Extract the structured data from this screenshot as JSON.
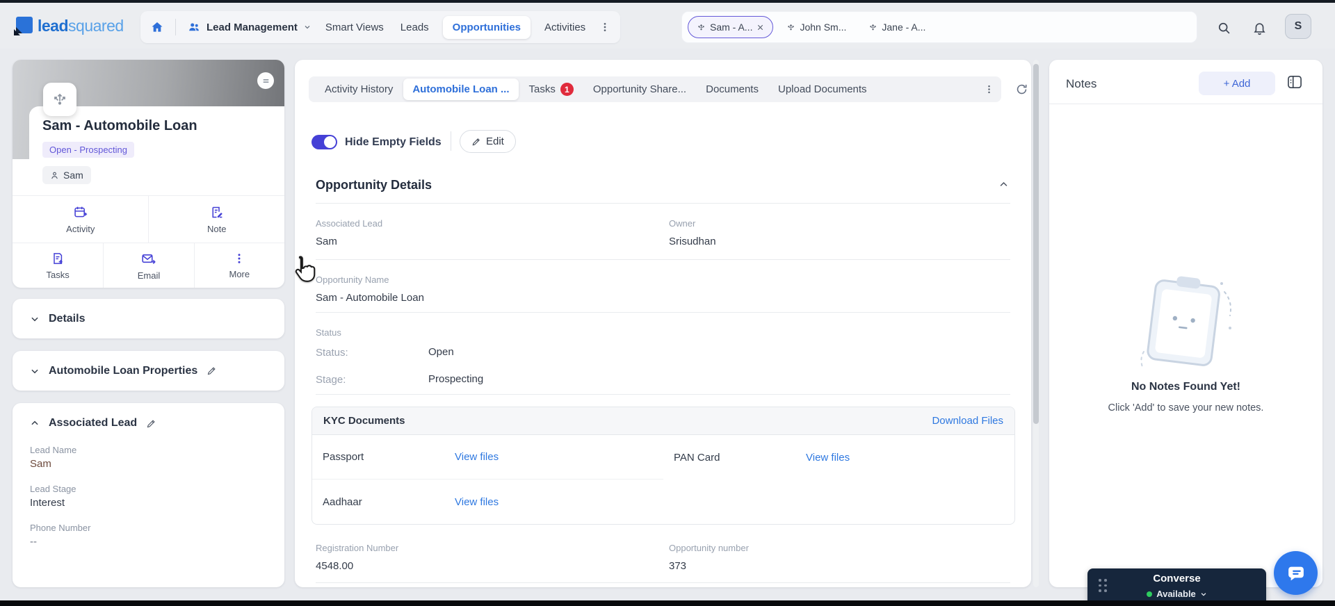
{
  "topbar": {
    "logo": {
      "part1": "lead",
      "part2": "squared"
    },
    "nav": {
      "lead_management": "Lead Management",
      "items": [
        "Smart Views",
        "Leads",
        "Opportunities",
        "Activities"
      ]
    },
    "chips": [
      {
        "label": "Sam - A...",
        "selected": true,
        "closable": true
      },
      {
        "label": "John Sm...",
        "selected": false
      },
      {
        "label": "Jane - A...",
        "selected": false
      }
    ],
    "avatar": "S"
  },
  "sidebar": {
    "title": "Sam - Automobile Loan",
    "status_badge": "Open - Prospecting",
    "lead_chip": "Sam",
    "actions": [
      "Activity",
      "Note",
      "Tasks",
      "Email",
      "More"
    ],
    "sections": {
      "details": "Details",
      "properties": "Automobile Loan Properties",
      "associated_lead": "Associated Lead"
    },
    "fields": [
      {
        "label": "Lead Name",
        "value": "Sam"
      },
      {
        "label": "Lead Stage",
        "value": "Interest"
      },
      {
        "label": "Phone Number",
        "value": "--"
      }
    ]
  },
  "main": {
    "tabs": [
      {
        "label": "Activity History"
      },
      {
        "label": "Automobile Loan ...",
        "active": true
      },
      {
        "label": "Tasks",
        "badge": "1"
      },
      {
        "label": "Opportunity Share..."
      },
      {
        "label": "Documents"
      },
      {
        "label": "Upload Documents"
      }
    ],
    "toggle_label": "Hide Empty Fields",
    "edit_label": "Edit",
    "section_title": "Opportunity Details",
    "fields": {
      "associated_lead": {
        "label": "Associated Lead",
        "value": "Sam"
      },
      "owner": {
        "label": "Owner",
        "value": "Srisudhan"
      },
      "opportunity_name": {
        "label": "Opportunity Name",
        "value": "Sam - Automobile Loan"
      },
      "registration_number": {
        "label": "Registration Number",
        "value": "4548.00"
      },
      "opportunity_number": {
        "label": "Opportunity number",
        "value": "373"
      }
    },
    "status": {
      "group_label": "Status",
      "status_label": "Status:",
      "status_value": "Open",
      "stage_label": "Stage:",
      "stage_value": "Prospecting"
    },
    "kyc": {
      "title": "KYC Documents",
      "download_label": "Download Files",
      "items": [
        {
          "name": "Passport",
          "link": "View files"
        },
        {
          "name": "PAN Card",
          "link": "View files"
        },
        {
          "name": "Aadhaar",
          "link": "View files"
        }
      ]
    }
  },
  "notes": {
    "title": "Notes",
    "add_label": "+ Add",
    "empty_title": "No Notes Found Yet!",
    "empty_subtitle": "Click 'Add' to save your new notes."
  },
  "converse": {
    "title": "Converse",
    "status": "Available"
  },
  "colors": {
    "accent_blue": "#2e6fd9",
    "accent_indigo": "#4540d6",
    "badge_bg": "#efecfb",
    "badge_text": "#6257d8",
    "tasks_badge_red": "#e02b3c",
    "link_blue": "#2e78e0",
    "converse_bg": "#16263c",
    "available_green": "#2ecc5f"
  },
  "icons": {
    "home": "house",
    "lead_management": "two-people",
    "overflow": "kebab-dots",
    "chip": "share-arrows",
    "close": "x",
    "search": "magnifier",
    "notifications": "bell",
    "opportunity": "share-arrows",
    "activity": "calendar-plus",
    "note": "note-pencil",
    "tasks": "file-plus",
    "email": "envelope-send",
    "more": "kebab-dots",
    "edit": "pencil",
    "refresh": "circular-arrow",
    "notes_panel": "side-panel",
    "chat": "speech-bubble",
    "drag": "drag-dots"
  }
}
